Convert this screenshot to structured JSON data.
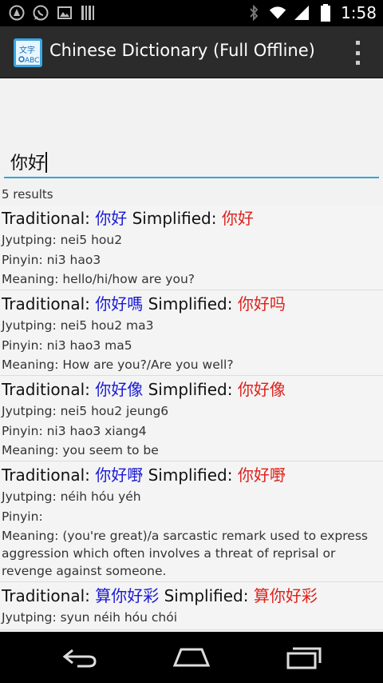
{
  "status_bar": {
    "time": "1:58",
    "left_icons": [
      "android-icon",
      "whatsapp-icon",
      "image-icon",
      "barcode-icon"
    ],
    "right_icons": [
      "bluetooth-icon",
      "wifi-icon",
      "signal-icon",
      "battery-icon"
    ]
  },
  "action_bar": {
    "title": "Chinese Dictionary (Full Offline)",
    "app_icon_label": "ABC"
  },
  "search": {
    "value": "你好",
    "placeholder": ""
  },
  "results_count": "5 results",
  "labels": {
    "traditional": "Traditional: ",
    "simplified": " Simplified: ",
    "jyutping": "Jyutping: ",
    "pinyin": "Pinyin: ",
    "meaning": "Meaning: "
  },
  "results": [
    {
      "traditional": "你好",
      "simplified": "你好",
      "jyutping": "nei5 hou2",
      "pinyin": "ni3 hao3",
      "meaning": "hello/hi/how are you?"
    },
    {
      "traditional": "你好嗎",
      "simplified": "你好吗",
      "jyutping": "nei5 hou2 ma3",
      "pinyin": "ni3 hao3 ma5",
      "meaning": "How are you?/Are you well?"
    },
    {
      "traditional": "你好像",
      "simplified": "你好像",
      "jyutping": "nei5 hou2 jeung6",
      "pinyin": "ni3 hao3 xiang4",
      "meaning": "you seem to be"
    },
    {
      "traditional": "你好嘢",
      "simplified": "你好嘢",
      "jyutping": "néih hóu yéh",
      "pinyin": "",
      "meaning": "(you're great)/a sarcastic remark used to express aggression which often involves a threat of reprisal or revenge against someone."
    },
    {
      "traditional": "算你好彩",
      "simplified": "算你好彩",
      "jyutping": "syun néih hóu chói",
      "pinyin": "",
      "meaning": ""
    }
  ],
  "nav_bar": [
    "back-icon",
    "home-icon",
    "recents-icon"
  ]
}
